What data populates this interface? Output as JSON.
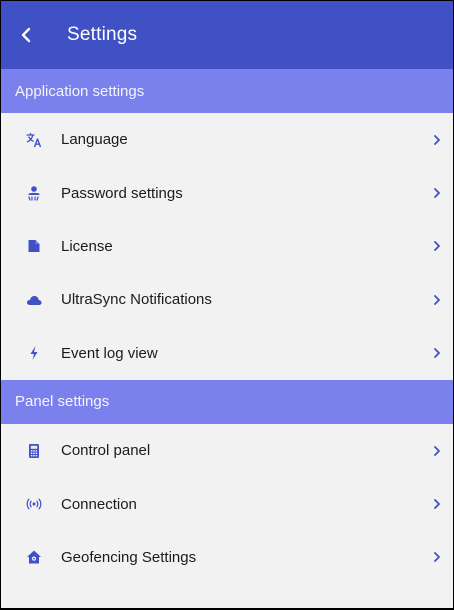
{
  "header": {
    "title": "Settings"
  },
  "colors": {
    "app_bar": "#3f51c5",
    "section_header": "#7a80ec",
    "background": "#f2f2f2",
    "accent": "#3f51c5"
  },
  "sections": [
    {
      "title": "Application settings",
      "items": [
        {
          "label": "Language",
          "icon": "translate-icon"
        },
        {
          "label": "Password settings",
          "icon": "user-lock-icon"
        },
        {
          "label": "License",
          "icon": "file-icon"
        },
        {
          "label": "UltraSync Notifications",
          "icon": "cloud-icon"
        },
        {
          "label": "Event log view",
          "icon": "bolt-icon"
        }
      ]
    },
    {
      "title": "Panel settings",
      "items": [
        {
          "label": "Control panel",
          "icon": "keypad-icon"
        },
        {
          "label": "Connection",
          "icon": "signal-icon"
        },
        {
          "label": "Geofencing Settings",
          "icon": "home-location-icon"
        }
      ]
    }
  ]
}
